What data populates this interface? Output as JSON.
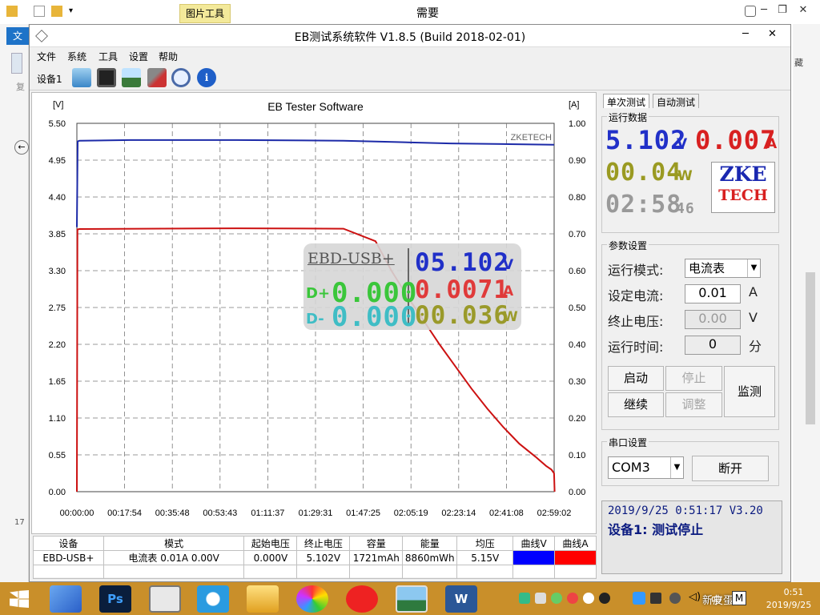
{
  "outer_window": {
    "ribbon_tag": "图片工具",
    "title": "需要",
    "left_letter": "文",
    "left_char": "复",
    "left_num": "17",
    "right_char": "藏"
  },
  "app": {
    "title": "EB测试系统软件 V1.8.5 (Build 2018-02-01)",
    "menus": [
      "文件",
      "系统",
      "工具",
      "设置",
      "帮助"
    ],
    "device_label": "设备1"
  },
  "chart_data": {
    "type": "line",
    "title": "EB Tester Software",
    "watermark": "ZKETECH",
    "ylabel_left": "[V]",
    "ylabel_right": "[A]",
    "ylim_left": [
      0,
      5.5
    ],
    "ylim_right": [
      0,
      1.0
    ],
    "y_ticks_left": [
      "5.50",
      "4.95",
      "4.40",
      "3.85",
      "3.30",
      "2.75",
      "2.20",
      "1.65",
      "1.10",
      "0.55",
      "0.00"
    ],
    "y_ticks_right": [
      "1.00",
      "0.90",
      "0.80",
      "0.70",
      "0.60",
      "0.50",
      "0.40",
      "0.30",
      "0.20",
      "0.10",
      "0.00"
    ],
    "x_ticks": [
      "00:00:00",
      "00:17:54",
      "00:35:48",
      "00:53:43",
      "01:11:37",
      "01:29:31",
      "01:47:25",
      "02:05:19",
      "02:23:14",
      "02:41:08",
      "02:59:02"
    ],
    "series": [
      {
        "axis": "left",
        "color": "#1c2aa8",
        "x_minutes": [
          0,
          0.3,
          1,
          20,
          60,
          100,
          120,
          140,
          160,
          179
        ],
        "y": [
          3.95,
          5.23,
          5.24,
          5.25,
          5.25,
          5.24,
          5.22,
          5.2,
          5.19,
          5.18
        ]
      },
      {
        "axis": "right",
        "color": "#cc1111",
        "x_minutes": [
          0,
          0.2,
          1,
          60,
          100,
          112,
          118,
          124,
          130,
          136,
          142,
          148,
          154,
          160,
          166,
          172,
          176,
          178,
          179,
          179.2
        ],
        "y": [
          0.0,
          0.712,
          0.713,
          0.715,
          0.714,
          0.68,
          0.6,
          0.53,
          0.465,
          0.4,
          0.34,
          0.28,
          0.225,
          0.175,
          0.13,
          0.095,
          0.07,
          0.06,
          0.05,
          0.0
        ]
      }
    ]
  },
  "badge": {
    "model": "EBD-USB+",
    "voltage": "05.102",
    "voltage_unit": "V",
    "current": "0.0071",
    "current_unit": "A",
    "power": "00.036",
    "power_unit": "W",
    "dplus_label": "D+",
    "dplus": "0.000",
    "dminus_label": "D-",
    "dminus": "0.000"
  },
  "right_panel": {
    "tabs": [
      "单次测试",
      "自动测试"
    ],
    "run_data_title": "运行数据",
    "voltage": "5.102",
    "voltage_unit": "V",
    "current": "0.007",
    "current_unit": "A",
    "power": "00.04",
    "power_unit": "W",
    "time": "02:58",
    "time_seconds": "46",
    "logo_top": "ZKE",
    "logo_bottom": "TECH",
    "params_title": "参数设置",
    "mode_label": "运行模式:",
    "mode_value": "电流表",
    "set_current_label": "设定电流:",
    "set_current_value": "0.01",
    "set_current_unit": "A",
    "stop_voltage_label": "终止电压:",
    "stop_voltage_value": "0.00",
    "stop_voltage_unit": "V",
    "run_time_label": "运行时间:",
    "run_time_value": "0",
    "run_time_unit": "分",
    "btn_start": "启动",
    "btn_stop": "停止",
    "btn_continue": "继续",
    "btn_adjust": "调整",
    "btn_monitor": "监测",
    "serial_title": "串口设置",
    "port": "COM3",
    "btn_disconnect": "断开",
    "status_line1": "2019/9/25 0:51:17  V3.20",
    "status_line2": "设备1: 测试停止"
  },
  "table": {
    "headers": [
      "设备",
      "模式",
      "起始电压",
      "终止电压",
      "容量",
      "能量",
      "均压",
      "曲线V",
      "曲线A"
    ],
    "row": [
      "EBD-USB+",
      "电流表  0.01A  0.00V",
      "0.000V",
      "5.102V",
      "1721mAh",
      "8860mWh",
      "5.15V"
    ],
    "curve_v_color": "#0000ff",
    "curve_a_color": "#ff0000"
  },
  "taskbar": {
    "watermark": "新皮蛋",
    "ime": "中",
    "ime2": "M",
    "clock_time": "0:51",
    "clock_date": "2019/9/25"
  }
}
